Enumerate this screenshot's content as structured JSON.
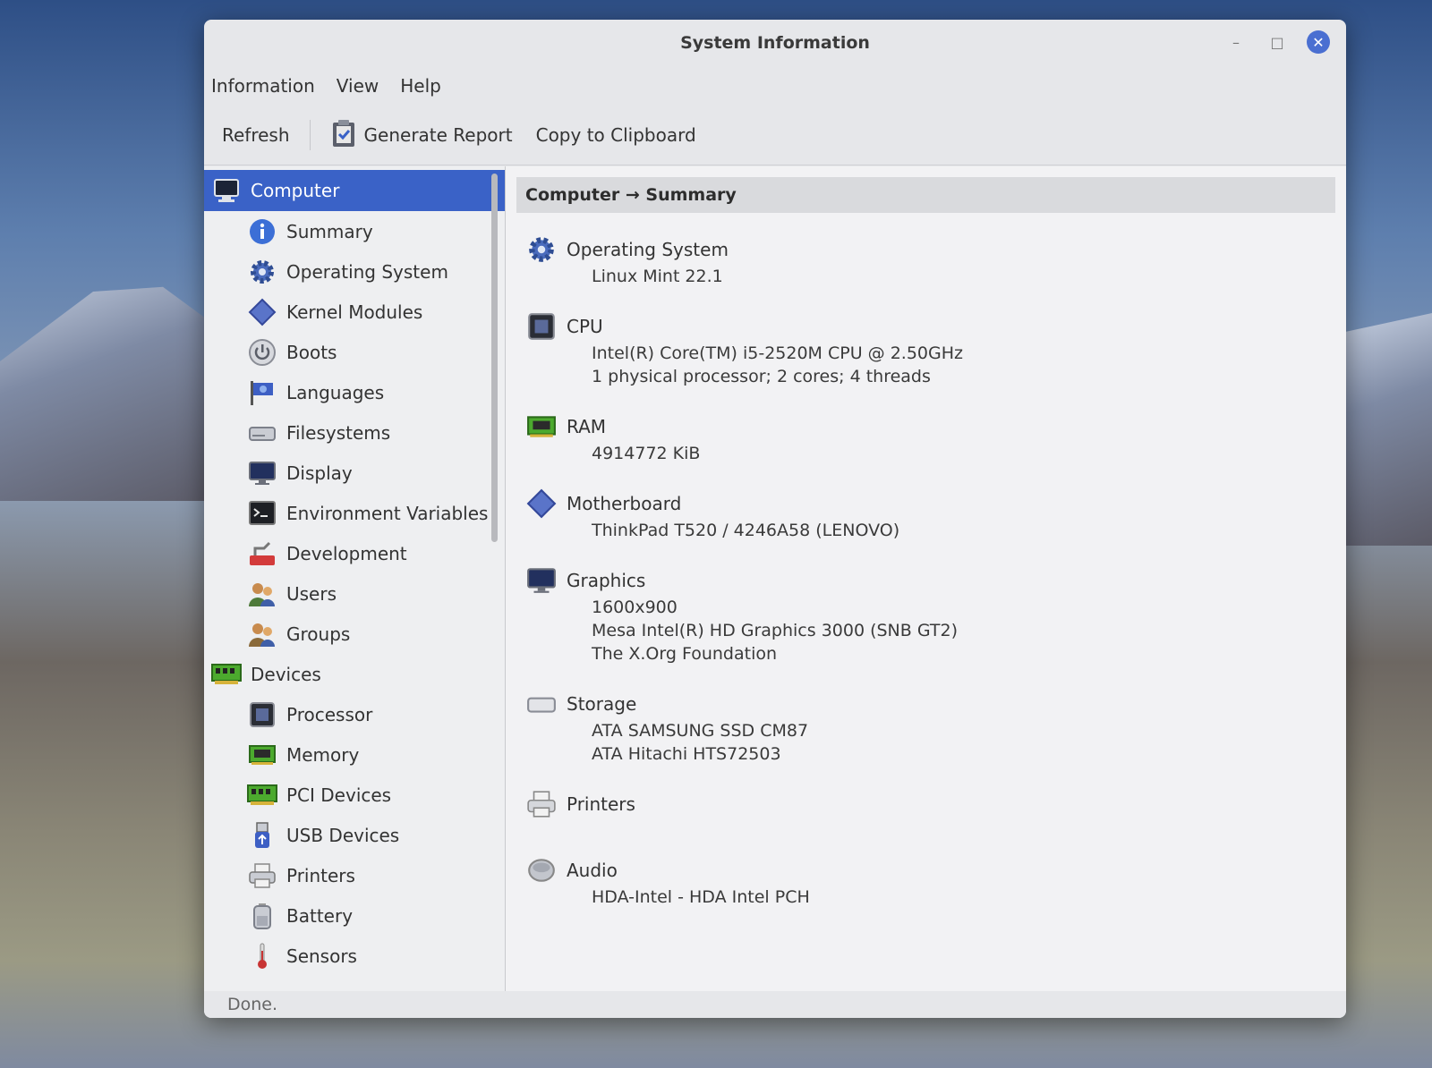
{
  "window": {
    "title": "System Information",
    "minimize": "–",
    "maximize": "□",
    "close": "✕"
  },
  "menu": [
    "Information",
    "View",
    "Help"
  ],
  "toolbar": {
    "refresh": "Refresh",
    "generate_report": "Generate Report",
    "copy_clipboard": "Copy to Clipboard"
  },
  "sidebar": {
    "computer": "Computer",
    "computer_items": [
      "Summary",
      "Operating System",
      "Kernel Modules",
      "Boots",
      "Languages",
      "Filesystems",
      "Display",
      "Environment Variables",
      "Development",
      "Users",
      "Groups"
    ],
    "devices": "Devices",
    "device_items": [
      "Processor",
      "Memory",
      "PCI Devices",
      "USB Devices",
      "Printers",
      "Battery",
      "Sensors"
    ]
  },
  "content": {
    "breadcrumb": "Computer → Summary",
    "sections": [
      {
        "name": "Operating System",
        "lines": [
          "Linux Mint 22.1"
        ]
      },
      {
        "name": "CPU",
        "lines": [
          "Intel(R) Core(TM) i5-2520M CPU @ 2.50GHz",
          "1 physical processor; 2 cores; 4 threads"
        ]
      },
      {
        "name": "RAM",
        "lines": [
          "4914772 KiB"
        ]
      },
      {
        "name": "Motherboard",
        "lines": [
          "ThinkPad T520 / 4246A58 (LENOVO)"
        ]
      },
      {
        "name": "Graphics",
        "lines": [
          "1600x900",
          "Mesa Intel(R) HD Graphics 3000 (SNB GT2)",
          "The X.Org Foundation"
        ]
      },
      {
        "name": "Storage",
        "lines": [
          "ATA SAMSUNG SSD CM87",
          "ATA Hitachi HTS72503"
        ]
      },
      {
        "name": "Printers",
        "lines": []
      },
      {
        "name": "Audio",
        "lines": [
          "HDA-Intel - HDA Intel PCH"
        ]
      }
    ]
  },
  "status": "Done."
}
